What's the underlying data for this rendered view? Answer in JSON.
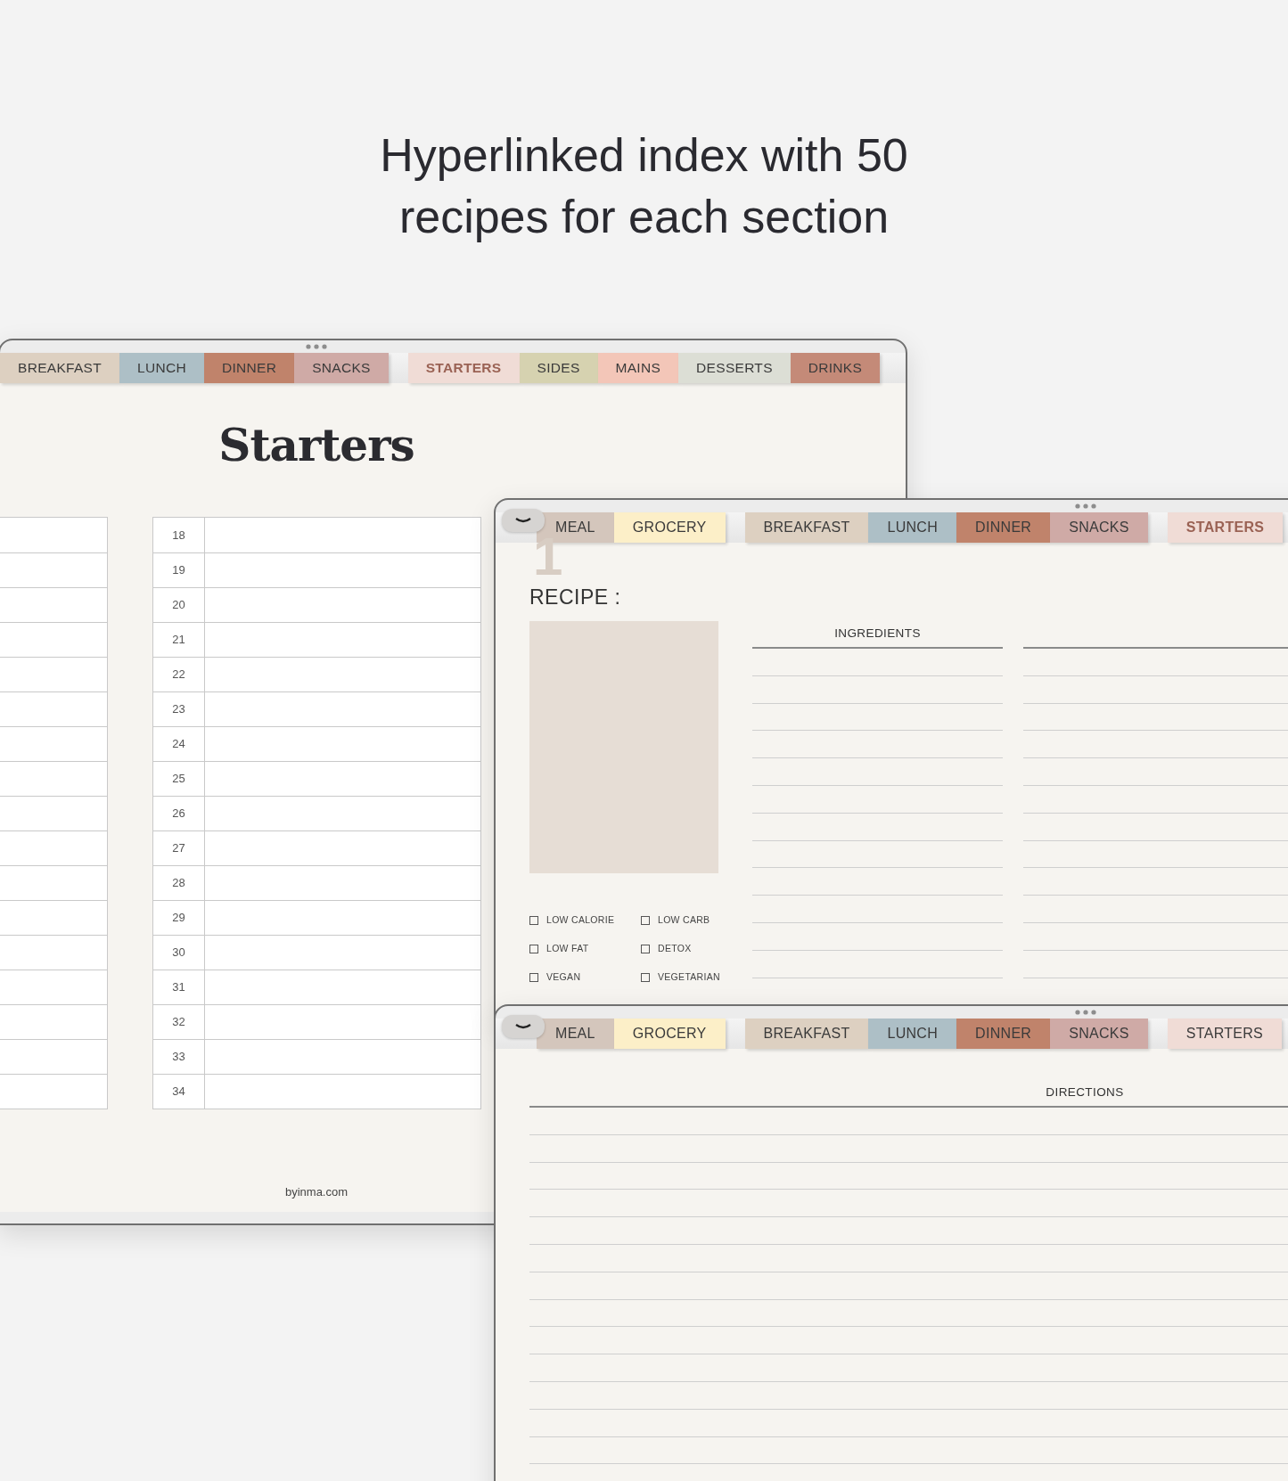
{
  "headline": "Hyperlinked index with 50 recipes for each section",
  "index_page": {
    "tabs": [
      {
        "label": "BREAKFAST",
        "color": "#ddd0c1",
        "selected": false,
        "group_start": false
      },
      {
        "label": "LUNCH",
        "color": "#adbfc6",
        "selected": false,
        "group_start": false
      },
      {
        "label": "DINNER",
        "color": "#c0836b",
        "selected": false,
        "group_start": false
      },
      {
        "label": "SNACKS",
        "color": "#cfaaa6",
        "selected": false,
        "group_start": false
      },
      {
        "label": "STARTERS",
        "color": "#f0dcd6",
        "selected": true,
        "group_start": true
      },
      {
        "label": "SIDES",
        "color": "#d6d2b0",
        "selected": false,
        "group_start": false
      },
      {
        "label": "MAINS",
        "color": "#f3c6b8",
        "selected": false,
        "group_start": false
      },
      {
        "label": "DESSERTS",
        "color": "#dcded5",
        "selected": false,
        "group_start": false
      },
      {
        "label": "DRINKS",
        "color": "#c48a78",
        "selected": false,
        "group_start": false
      }
    ],
    "title": "Starters",
    "rows": [
      {
        "number": "18"
      },
      {
        "number": "19"
      },
      {
        "number": "20"
      },
      {
        "number": "21"
      },
      {
        "number": "22"
      },
      {
        "number": "23"
      },
      {
        "number": "24"
      },
      {
        "number": "25"
      },
      {
        "number": "26"
      },
      {
        "number": "27"
      },
      {
        "number": "28"
      },
      {
        "number": "29"
      },
      {
        "number": "30"
      },
      {
        "number": "31"
      },
      {
        "number": "32"
      },
      {
        "number": "33"
      },
      {
        "number": "34"
      }
    ],
    "footer": "byinma.com"
  },
  "recipe_page": {
    "tabs": [
      {
        "label": "MEAL",
        "color": "#d4c6bc",
        "selected": false,
        "group_start": false
      },
      {
        "label": "GROCERY",
        "color": "#fcefc8",
        "selected": false,
        "group_start": false
      },
      {
        "label": "BREAKFAST",
        "color": "#ddd0c1",
        "selected": false,
        "group_start": true
      },
      {
        "label": "LUNCH",
        "color": "#adbfc6",
        "selected": false,
        "group_start": false
      },
      {
        "label": "DINNER",
        "color": "#c0836b",
        "selected": false,
        "group_start": false
      },
      {
        "label": "SNACKS",
        "color": "#cfaaa6",
        "selected": false,
        "group_start": false
      },
      {
        "label": "STARTERS",
        "color": "#f0dcd6",
        "selected": true,
        "group_start": true
      }
    ],
    "recipe_number": "1",
    "recipe_label": "RECIPE :",
    "ingredients_heading": "INGREDIENTS",
    "diet_options": [
      {
        "label": "LOW CALORIE",
        "checked": false
      },
      {
        "label": "LOW CARB",
        "checked": false
      },
      {
        "label": "LOW FAT",
        "checked": false
      },
      {
        "label": "DETOX",
        "checked": false
      },
      {
        "label": "VEGAN",
        "checked": false
      },
      {
        "label": "VEGETARIAN",
        "checked": false
      }
    ]
  },
  "directions_page": {
    "tabs": [
      {
        "label": "MEAL",
        "color": "#d4c6bc",
        "selected": false,
        "group_start": false
      },
      {
        "label": "GROCERY",
        "color": "#fcefc8",
        "selected": false,
        "group_start": false
      },
      {
        "label": "BREAKFAST",
        "color": "#ddd0c1",
        "selected": false,
        "group_start": true
      },
      {
        "label": "LUNCH",
        "color": "#adbfc6",
        "selected": false,
        "group_start": false
      },
      {
        "label": "DINNER",
        "color": "#c0836b",
        "selected": false,
        "group_start": false
      },
      {
        "label": "SNACKS",
        "color": "#cfaaa6",
        "selected": false,
        "group_start": false
      },
      {
        "label": "STARTERS",
        "color": "#f0dcd6",
        "selected": false,
        "group_start": true
      }
    ],
    "directions_heading": "DIRECTIONS"
  }
}
